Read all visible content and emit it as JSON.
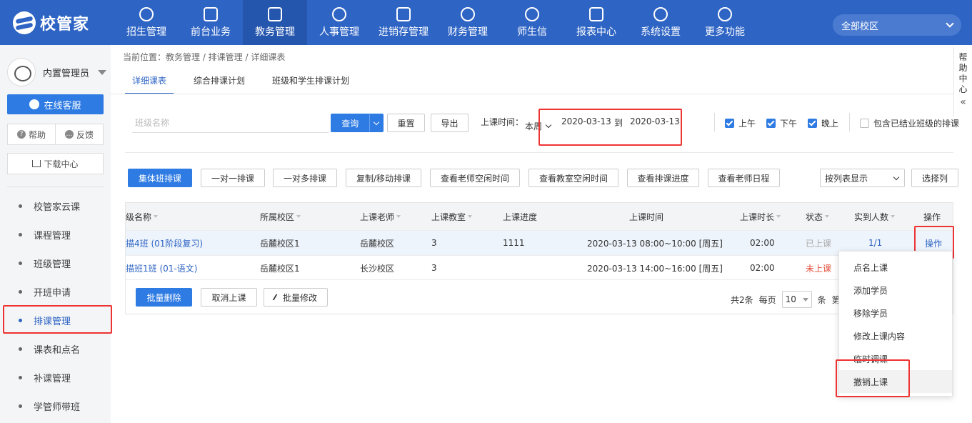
{
  "app": {
    "logo_text": "校管家",
    "campus": "全部校区"
  },
  "nav": [
    {
      "label": "招生管理",
      "icon": "person-plus-icon"
    },
    {
      "label": "前台业务",
      "icon": "monitor-icon"
    },
    {
      "label": "教务管理",
      "icon": "book-icon",
      "active": true
    },
    {
      "label": "人事管理",
      "icon": "person-icon"
    },
    {
      "label": "进销存管理",
      "icon": "box-arrow-icon"
    },
    {
      "label": "财务管理",
      "icon": "money-icon"
    },
    {
      "label": "师生信",
      "icon": "chat-icon"
    },
    {
      "label": "报表中心",
      "icon": "bar-chart-icon"
    },
    {
      "label": "系统设置",
      "icon": "gear-icon"
    },
    {
      "label": "更多功能",
      "icon": "more-icon"
    }
  ],
  "sidebar": {
    "user_name": "内置管理员",
    "service_label": "在线客服",
    "help_label": "帮助",
    "feedback_label": "反馈",
    "download_label": "下载中心",
    "items": [
      {
        "label": "校管家云课"
      },
      {
        "label": "课程管理"
      },
      {
        "label": "班级管理"
      },
      {
        "label": "开班申请"
      },
      {
        "label": "排课管理",
        "active": true
      },
      {
        "label": "课表和点名"
      },
      {
        "label": "补课管理"
      },
      {
        "label": "学管师带班"
      }
    ]
  },
  "breadcrumb": "当前位置：教务管理 / 排课管理 / 详细课表",
  "tabs": [
    "详细课表",
    "综合排课计划",
    "班级和学生排课计划"
  ],
  "filter": {
    "class_placeholder": "班级名称",
    "query_label": "查询",
    "reset_label": "重置",
    "export_label": "导出",
    "time_label": "上课时间：",
    "week_option": "本周",
    "date_from": "2020-03-13",
    "to_label": "到",
    "date_to": "2020-03-13",
    "morning": "上午",
    "afternoon": "下午",
    "evening": "晚上",
    "include_graduated": "包含已结业班级的排课"
  },
  "actions": {
    "group_class": "集体班排课",
    "one_to_one": "一对一排课",
    "one_to_many": "一对多排课",
    "copy_move": "复制/移动排课",
    "teacher_free": "查看老师空闲时间",
    "room_free": "查看教室空闲时间",
    "progress": "查看排课进度",
    "teacher_schedule": "查看老师日程",
    "view_mode": "按列表显示",
    "select_columns": "选择列"
  },
  "table": {
    "headers": {
      "class_name": "级名称",
      "campus": "所属校区",
      "teacher": "上课老师",
      "room": "上课教室",
      "progress": "上课进度",
      "time": "上课时间",
      "duration": "上课时长",
      "status": "状态",
      "attendance": "实到人数",
      "op": "操作"
    },
    "rows": [
      {
        "class_name": "描4班 (01阶段复习)",
        "campus": "岳麓校区1",
        "teacher": "岳麓校区",
        "room": "3",
        "progress": "1111",
        "time": "2020-03-13 08:00~10:00 [周五]",
        "duration": "02:00",
        "status": "已上课",
        "attendance": "1/1",
        "op": "操作"
      },
      {
        "class_name": "描班1班 (01-语文)",
        "campus": "岳麓校区1",
        "teacher": "长沙校区",
        "room": "3",
        "progress": "",
        "time": "2020-03-13 14:00~16:00 [周五]",
        "duration": "02:00",
        "status": "未上课",
        "attendance": "",
        "op": ""
      }
    ]
  },
  "footer": {
    "batch_delete": "批量删除",
    "cancel_class": "取消上课",
    "batch_edit": "批量修改",
    "total": "共2条",
    "per_page_label": "每页",
    "page_size": "10",
    "unit": "条",
    "unit_extra": "第"
  },
  "dropdown": [
    "点名上课",
    "添加学员",
    "移除学员",
    "修改上课内容",
    "临时调课",
    "撤销上课"
  ],
  "help_side": [
    "帮",
    "助",
    "中",
    "心"
  ],
  "colors": {
    "brand": "#2e64c4",
    "primary_button": "#2e7be3",
    "highlight": "#e33333",
    "status_todo": "#e5503a"
  }
}
